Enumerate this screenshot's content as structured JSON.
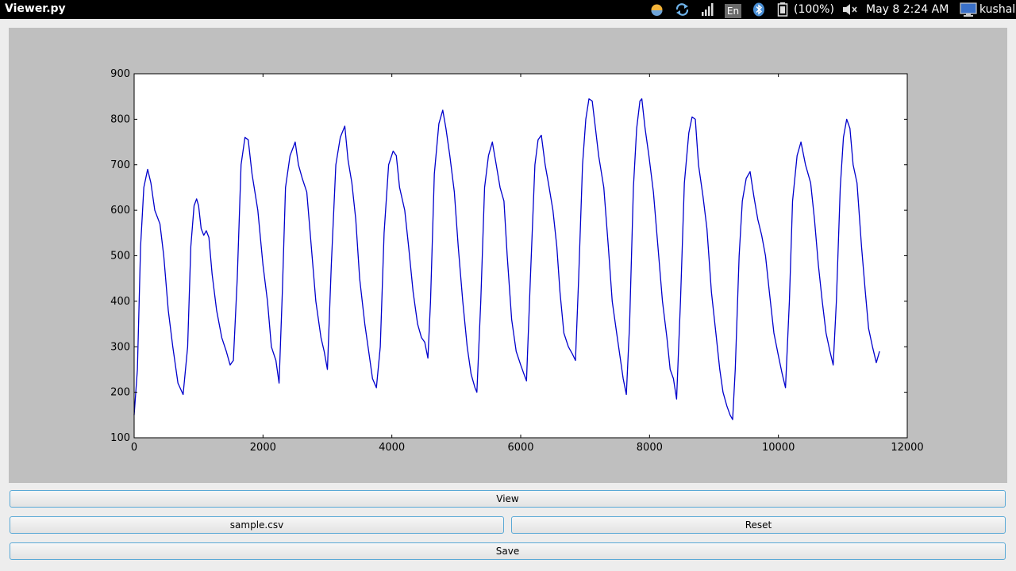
{
  "window": {
    "title": "Viewer.py"
  },
  "tray": {
    "lang": "En",
    "battery": "(100%)",
    "datetime": "May  8  2:24 AM",
    "user": "kushal"
  },
  "buttons": {
    "view": "View",
    "file": "sample.csv",
    "reset": "Reset",
    "save": "Save"
  },
  "chart_data": {
    "type": "line",
    "title": "",
    "xlabel": "",
    "ylabel": "",
    "xlim": [
      0,
      12000
    ],
    "ylim": [
      100,
      900
    ],
    "xticks": [
      0,
      2000,
      4000,
      6000,
      8000,
      10000,
      12000
    ],
    "yticks": [
      100,
      200,
      300,
      400,
      500,
      600,
      700,
      800,
      900
    ],
    "grid": false,
    "series": [
      {
        "color": "#0000cc",
        "points": [
          [
            0,
            150
          ],
          [
            50,
            250
          ],
          [
            100,
            520
          ],
          [
            150,
            650
          ],
          [
            210,
            690
          ],
          [
            260,
            660
          ],
          [
            320,
            600
          ],
          [
            400,
            570
          ],
          [
            460,
            500
          ],
          [
            530,
            380
          ],
          [
            600,
            300
          ],
          [
            680,
            220
          ],
          [
            760,
            195
          ],
          [
            830,
            300
          ],
          [
            880,
            520
          ],
          [
            930,
            610
          ],
          [
            970,
            625
          ],
          [
            1000,
            610
          ],
          [
            1040,
            560
          ],
          [
            1080,
            545
          ],
          [
            1120,
            555
          ],
          [
            1160,
            540
          ],
          [
            1210,
            460
          ],
          [
            1280,
            380
          ],
          [
            1360,
            320
          ],
          [
            1430,
            290
          ],
          [
            1490,
            260
          ],
          [
            1540,
            270
          ],
          [
            1600,
            450
          ],
          [
            1660,
            700
          ],
          [
            1720,
            760
          ],
          [
            1770,
            755
          ],
          [
            1830,
            680
          ],
          [
            1920,
            600
          ],
          [
            2000,
            480
          ],
          [
            2070,
            400
          ],
          [
            2130,
            300
          ],
          [
            2200,
            270
          ],
          [
            2250,
            220
          ],
          [
            2300,
            420
          ],
          [
            2350,
            650
          ],
          [
            2420,
            720
          ],
          [
            2500,
            750
          ],
          [
            2550,
            700
          ],
          [
            2610,
            670
          ],
          [
            2680,
            640
          ],
          [
            2750,
            520
          ],
          [
            2820,
            400
          ],
          [
            2900,
            320
          ],
          [
            2950,
            290
          ],
          [
            3000,
            250
          ],
          [
            3060,
            480
          ],
          [
            3130,
            700
          ],
          [
            3200,
            760
          ],
          [
            3270,
            785
          ],
          [
            3320,
            710
          ],
          [
            3380,
            660
          ],
          [
            3440,
            580
          ],
          [
            3500,
            450
          ],
          [
            3580,
            350
          ],
          [
            3650,
            280
          ],
          [
            3700,
            230
          ],
          [
            3760,
            210
          ],
          [
            3820,
            300
          ],
          [
            3880,
            550
          ],
          [
            3950,
            700
          ],
          [
            4020,
            730
          ],
          [
            4070,
            720
          ],
          [
            4120,
            650
          ],
          [
            4200,
            600
          ],
          [
            4260,
            520
          ],
          [
            4330,
            420
          ],
          [
            4400,
            350
          ],
          [
            4460,
            320
          ],
          [
            4510,
            310
          ],
          [
            4560,
            275
          ],
          [
            4600,
            400
          ],
          [
            4660,
            680
          ],
          [
            4730,
            790
          ],
          [
            4790,
            820
          ],
          [
            4840,
            780
          ],
          [
            4900,
            720
          ],
          [
            4970,
            640
          ],
          [
            5030,
            520
          ],
          [
            5100,
            400
          ],
          [
            5170,
            300
          ],
          [
            5230,
            240
          ],
          [
            5290,
            210
          ],
          [
            5320,
            200
          ],
          [
            5380,
            400
          ],
          [
            5440,
            650
          ],
          [
            5500,
            720
          ],
          [
            5560,
            750
          ],
          [
            5620,
            700
          ],
          [
            5680,
            650
          ],
          [
            5740,
            620
          ],
          [
            5790,
            500
          ],
          [
            5860,
            360
          ],
          [
            5930,
            290
          ],
          [
            6000,
            260
          ],
          [
            6050,
            240
          ],
          [
            6090,
            225
          ],
          [
            6150,
            450
          ],
          [
            6220,
            700
          ],
          [
            6270,
            755
          ],
          [
            6320,
            765
          ],
          [
            6380,
            700
          ],
          [
            6430,
            660
          ],
          [
            6500,
            600
          ],
          [
            6560,
            520
          ],
          [
            6610,
            420
          ],
          [
            6670,
            330
          ],
          [
            6740,
            300
          ],
          [
            6800,
            285
          ],
          [
            6850,
            270
          ],
          [
            6900,
            450
          ],
          [
            6960,
            700
          ],
          [
            7010,
            800
          ],
          [
            7060,
            845
          ],
          [
            7110,
            840
          ],
          [
            7160,
            780
          ],
          [
            7210,
            720
          ],
          [
            7290,
            650
          ],
          [
            7360,
            520
          ],
          [
            7420,
            400
          ],
          [
            7490,
            330
          ],
          [
            7540,
            280
          ],
          [
            7590,
            230
          ],
          [
            7640,
            195
          ],
          [
            7690,
            350
          ],
          [
            7750,
            650
          ],
          [
            7800,
            780
          ],
          [
            7850,
            840
          ],
          [
            7880,
            845
          ],
          [
            7930,
            780
          ],
          [
            7990,
            720
          ],
          [
            8060,
            640
          ],
          [
            8130,
            520
          ],
          [
            8200,
            400
          ],
          [
            8270,
            320
          ],
          [
            8320,
            250
          ],
          [
            8370,
            230
          ],
          [
            8420,
            185
          ],
          [
            8480,
            400
          ],
          [
            8540,
            660
          ],
          [
            8610,
            770
          ],
          [
            8660,
            805
          ],
          [
            8710,
            800
          ],
          [
            8760,
            700
          ],
          [
            8830,
            630
          ],
          [
            8890,
            560
          ],
          [
            8960,
            420
          ],
          [
            9030,
            330
          ],
          [
            9090,
            250
          ],
          [
            9140,
            200
          ],
          [
            9200,
            170
          ],
          [
            9250,
            150
          ],
          [
            9290,
            140
          ],
          [
            9330,
            250
          ],
          [
            9390,
            500
          ],
          [
            9440,
            620
          ],
          [
            9500,
            670
          ],
          [
            9560,
            685
          ],
          [
            9620,
            630
          ],
          [
            9680,
            580
          ],
          [
            9740,
            545
          ],
          [
            9800,
            500
          ],
          [
            9860,
            420
          ],
          [
            9930,
            330
          ],
          [
            10000,
            280
          ],
          [
            10060,
            240
          ],
          [
            10110,
            210
          ],
          [
            10170,
            400
          ],
          [
            10220,
            620
          ],
          [
            10290,
            720
          ],
          [
            10350,
            750
          ],
          [
            10420,
            700
          ],
          [
            10500,
            660
          ],
          [
            10560,
            580
          ],
          [
            10620,
            480
          ],
          [
            10680,
            400
          ],
          [
            10740,
            330
          ],
          [
            10800,
            290
          ],
          [
            10850,
            260
          ],
          [
            10900,
            400
          ],
          [
            10960,
            650
          ],
          [
            11010,
            760
          ],
          [
            11060,
            800
          ],
          [
            11110,
            780
          ],
          [
            11160,
            700
          ],
          [
            11220,
            660
          ],
          [
            11290,
            520
          ],
          [
            11350,
            420
          ],
          [
            11400,
            340
          ],
          [
            11460,
            300
          ],
          [
            11520,
            265
          ],
          [
            11570,
            290
          ]
        ]
      }
    ]
  }
}
